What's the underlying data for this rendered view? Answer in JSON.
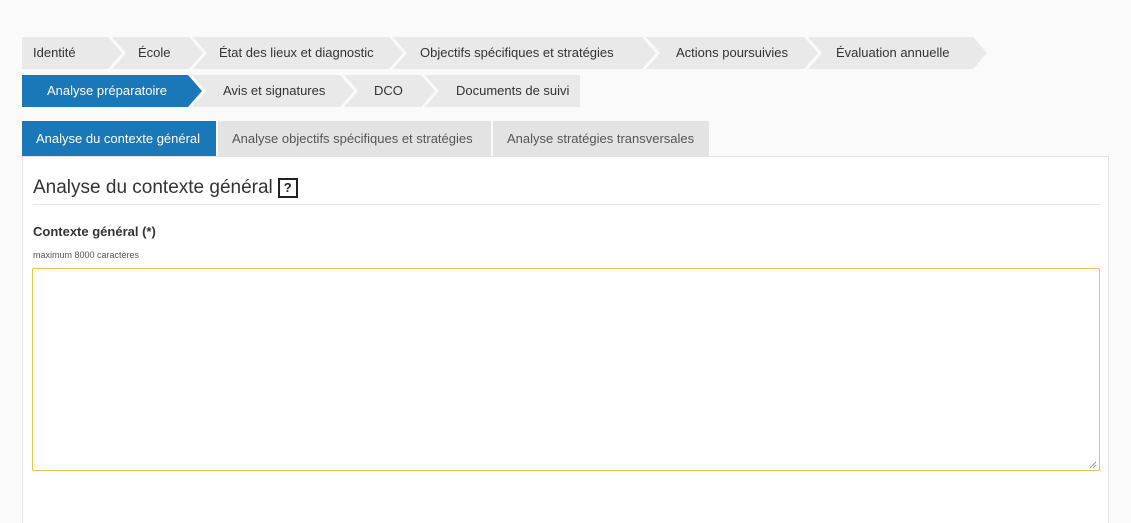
{
  "steps_row1": [
    {
      "label": "Identité"
    },
    {
      "label": "École"
    },
    {
      "label": "État des lieux et diagnostic"
    },
    {
      "label": "Objectifs spécifiques et stratégies"
    },
    {
      "label": "Actions poursuivies"
    },
    {
      "label": "Évaluation annuelle"
    }
  ],
  "steps_row2": [
    {
      "label": "Analyse préparatoire",
      "active": true
    },
    {
      "label": "Avis et signatures"
    },
    {
      "label": "DCO"
    },
    {
      "label": "Documents de suivi"
    }
  ],
  "tabs": [
    {
      "label": "Analyse du contexte général",
      "active": true
    },
    {
      "label": "Analyse objectifs spécifiques et stratégies"
    },
    {
      "label": "Analyse stratégies transversales"
    }
  ],
  "panel": {
    "title": "Analyse du contexte général",
    "help_label": "?",
    "field_label": "Contexte général (*)",
    "field_hint": "maximum 8000 caractères",
    "field_value": "",
    "field_placeholder": ""
  },
  "colors": {
    "accent": "#1a78b8",
    "step_bg": "#e9e9e9",
    "input_border": "#e5c35a"
  }
}
